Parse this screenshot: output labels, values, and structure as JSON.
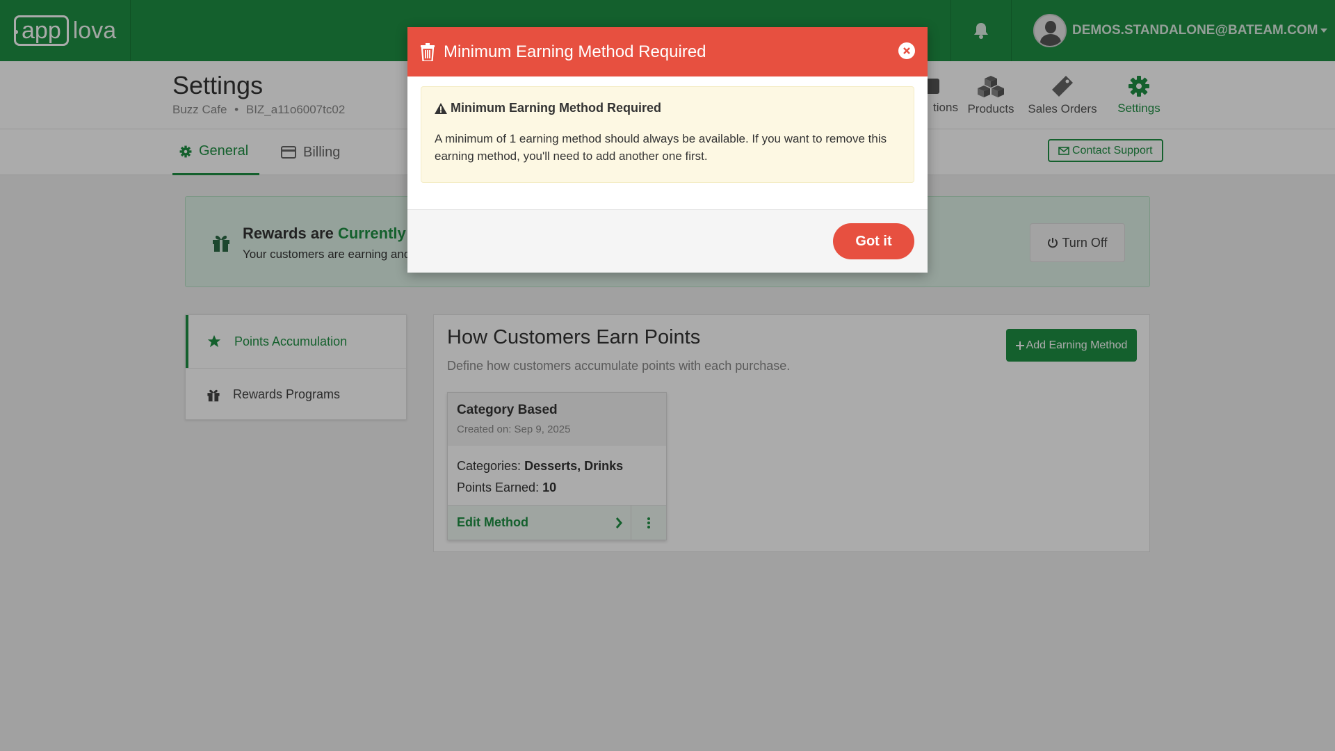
{
  "brand": {
    "logo_box": "app",
    "logo_rest": "lova",
    "green": "#1f8f43",
    "red": "#e75040"
  },
  "topbar": {
    "user_email": "DEMOS.STANDALONE@BATEAM.COM"
  },
  "header": {
    "title": "Settings",
    "business": "Buzz Cafe",
    "business_id": "BIZ_a11o6007tc02",
    "nav": [
      {
        "label": "tions",
        "icon": "tag-icon"
      },
      {
        "label": "Products",
        "icon": "boxes-icon"
      },
      {
        "label": "Sales Orders",
        "icon": "ticket-icon"
      },
      {
        "label": "Settings",
        "icon": "gear-icon"
      }
    ]
  },
  "tabs": [
    {
      "label": "General",
      "icon": "gear-icon"
    },
    {
      "label": "Billing",
      "icon": "credit-card-icon"
    }
  ],
  "contact_support": "Contact Support",
  "banner": {
    "title_prefix": "Rewards are",
    "title_highlight": "Currently A",
    "subtitle": "Your customers are earning and",
    "turn_off": "Turn Off"
  },
  "sidebar": {
    "items": [
      {
        "label": "Points Accumulation",
        "icon": "star-icon"
      },
      {
        "label": "Rewards Programs",
        "icon": "gift-icon"
      }
    ]
  },
  "panel": {
    "title": "How Customers Earn Points",
    "subtitle": "Define how customers accumulate points with each purchase.",
    "add_button": "Add Earning Method"
  },
  "card": {
    "title": "Category Based",
    "created": "Created on: Sep 9, 2025",
    "categories_label": "Categories:",
    "categories_value": "Desserts, Drinks",
    "points_label": "Points Earned:",
    "points_value": "10",
    "edit": "Edit Method"
  },
  "modal": {
    "title": "Minimum Earning Method Required",
    "alert_title": "Minimum Earning Method Required",
    "alert_text": "A minimum of 1 earning method should always be available. If you want to remove this earning method, you'll need to add another one first.",
    "button": "Got it"
  }
}
